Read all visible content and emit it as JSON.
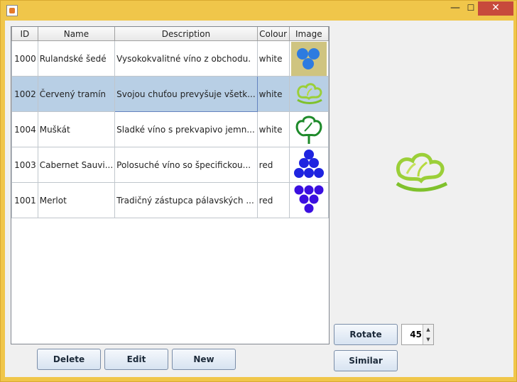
{
  "window": {
    "min_symbol": "—",
    "max_symbol": "☐",
    "close_symbol": "✕"
  },
  "table": {
    "headers": [
      "ID",
      "Name",
      "Description",
      "Colour",
      "Image"
    ],
    "rows": [
      {
        "id": "1000",
        "name": "Rulandské šedé",
        "description": "Vysokokvalitné víno z obchodu.",
        "colour": "white",
        "image": "grapes-blue-on-khaki-icon"
      },
      {
        "id": "1002",
        "name": "Červený tramín",
        "description": "Svojou chuťou prevyšuje všetk...",
        "colour": "white",
        "image": "vine-leaf-green-icon"
      },
      {
        "id": "1004",
        "name": "Muškát",
        "description": "Sladké víno s prekvapivo jemn...",
        "colour": "white",
        "image": "vine-leaf-dark-green-icon"
      },
      {
        "id": "1003",
        "name": "Cabernet Sauvi...",
        "description": "Polosuché víno so špecifickou...",
        "colour": "red",
        "image": "grape-cluster-blue-icon"
      },
      {
        "id": "1001",
        "name": "Merlot",
        "description": "Tradičný zástupca pálavských ...",
        "colour": "red",
        "image": "grape-cluster-violet-icon"
      }
    ],
    "selected_row": 1
  },
  "buttons": {
    "delete": "Delete",
    "edit": "Edit",
    "new": "New",
    "rotate": "Rotate",
    "similar": "Similar"
  },
  "rotation": {
    "value": "45"
  },
  "preview": {
    "image": "vine-leaf-green-icon"
  },
  "colors": {
    "selected_row": "#b8cfe5",
    "title_bar": "#f0c64a",
    "close_button": "#c74a3c"
  }
}
